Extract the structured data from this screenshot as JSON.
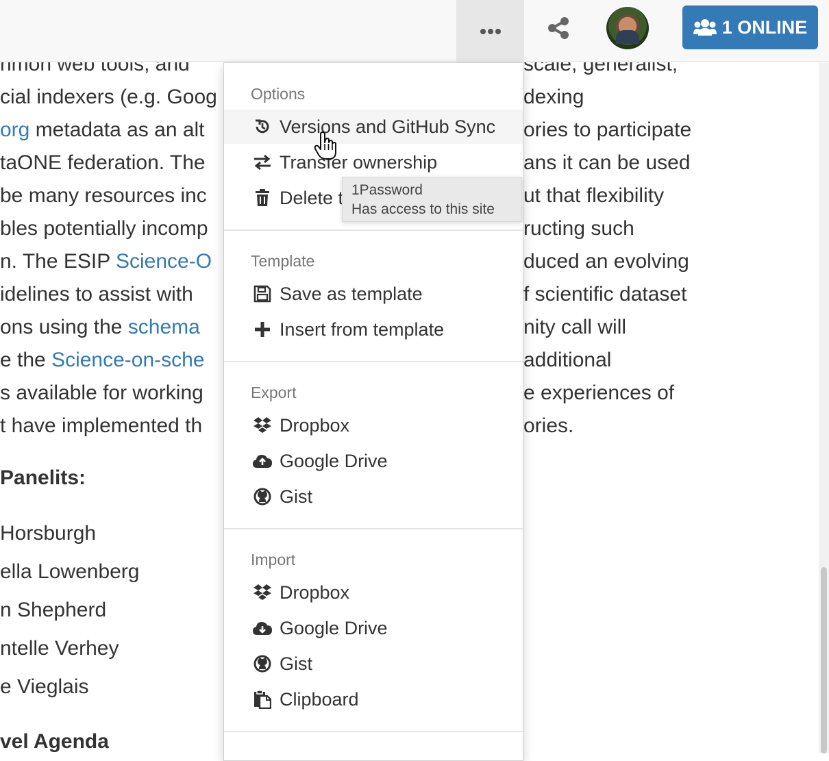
{
  "navbar": {
    "more_icon": "ellipsis-icon",
    "share_icon": "share-icon",
    "online_label": "1 ONLINE",
    "online_icon": "users-icon"
  },
  "document": {
    "lines": [
      {
        "pre": "nmon web tools, and",
        "link": "",
        "post": ""
      },
      {
        "pre": "cial indexers (e.g. Goog",
        "link": "",
        "post": ""
      },
      {
        "pre": "",
        "link": "org",
        "post": " metadata as an alt"
      },
      {
        "pre": "taONE federation. The",
        "link": "",
        "post": ""
      },
      {
        "pre": "be many resources inc",
        "link": "",
        "post": ""
      },
      {
        "pre": "bles potentially incomp",
        "link": "",
        "post": ""
      },
      {
        "pre": "n. The ESIP ",
        "link": "Science-O",
        "post": ""
      },
      {
        "pre": "idelines to assist with",
        "link": "",
        "post": ""
      },
      {
        "pre": "ons using the ",
        "link": "schema",
        "post": ""
      },
      {
        "pre": "e the ",
        "link": "Science-on-sche",
        "post": ""
      },
      {
        "pre": "s available for working",
        "link": "",
        "post": ""
      },
      {
        "pre": "t have implemented th",
        "link": "",
        "post": ""
      }
    ],
    "right_lines": [
      "scale, generalist,",
      "dexing",
      "ories to participate",
      "ans it can be used",
      "ut that flexibility",
      "ructing such",
      "duced an evolving",
      "f scientific dataset",
      "nity call will",
      "additional",
      "e experiences of",
      "ories."
    ],
    "panelists_heading": "Panelits:",
    "panelists": [
      "Horsburgh",
      "ella Lowenberg",
      "n Shepherd",
      "ntelle Verhey",
      "e Vieglais"
    ],
    "agenda_heading": "vel Agenda"
  },
  "menu": {
    "sections": [
      {
        "header": "Options",
        "items": [
          {
            "label": "Versions and GitHub Sync",
            "icon": "history-icon"
          },
          {
            "label": "Transfer ownership",
            "icon": "exchange-icon"
          },
          {
            "label": "Delete this note",
            "icon": "trash-icon"
          }
        ]
      },
      {
        "header": "Template",
        "items": [
          {
            "label": "Save as template",
            "icon": "save-icon"
          },
          {
            "label": "Insert from template",
            "icon": "plus-icon"
          }
        ]
      },
      {
        "header": "Export",
        "items": [
          {
            "label": "Dropbox",
            "icon": "dropbox-icon"
          },
          {
            "label": "Google Drive",
            "icon": "cloud-upload-icon"
          },
          {
            "label": "Gist",
            "icon": "github-icon"
          }
        ]
      },
      {
        "header": "Import",
        "items": [
          {
            "label": "Dropbox",
            "icon": "dropbox-icon"
          },
          {
            "label": "Google Drive",
            "icon": "cloud-download-icon"
          },
          {
            "label": "Gist",
            "icon": "github-icon"
          },
          {
            "label": "Clipboard",
            "icon": "clipboard-icon"
          }
        ]
      }
    ]
  },
  "tooltip": {
    "title": "1Password",
    "subtitle": "Has access to this site"
  },
  "colors": {
    "link": "#337ab7",
    "online_button": "#337ab7"
  }
}
